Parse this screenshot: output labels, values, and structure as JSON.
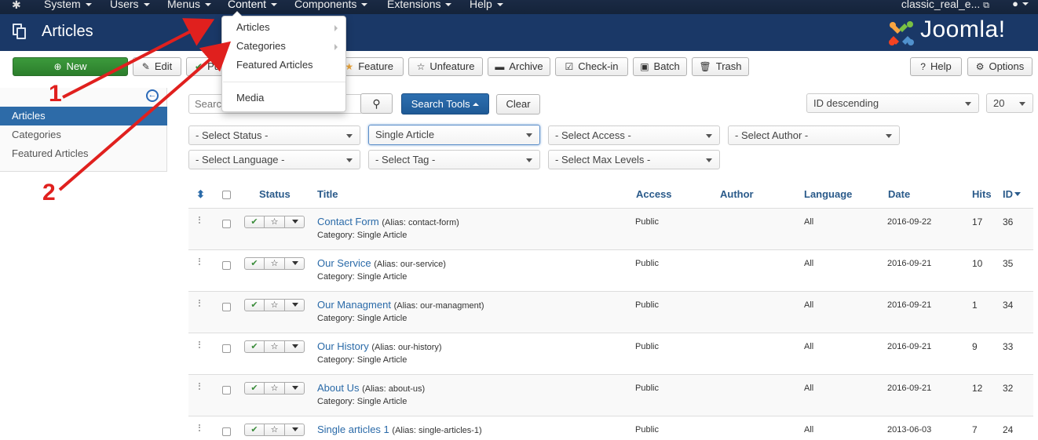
{
  "topnav": {
    "items": [
      {
        "label": "System"
      },
      {
        "label": "Users"
      },
      {
        "label": "Menus"
      },
      {
        "label": "Content"
      },
      {
        "label": "Components"
      },
      {
        "label": "Extensions"
      },
      {
        "label": "Help"
      }
    ],
    "site_name": "classic_real_e...",
    "external_icon": "external-link-icon",
    "user_icon": "user-icon"
  },
  "header": {
    "title": "Articles",
    "brand": "Joomla!"
  },
  "toolbar": {
    "new": "New",
    "edit": "Edit",
    "publish": "Pu",
    "feature": "Feature",
    "unfeature": "Unfeature",
    "archive": "Archive",
    "checkin": "Check-in",
    "batch": "Batch",
    "trash": "Trash",
    "help": "Help",
    "options": "Options"
  },
  "content_menu": {
    "items": [
      {
        "label": "Articles",
        "has_submenu": true
      },
      {
        "label": "Categories",
        "has_submenu": true
      },
      {
        "label": "Featured Articles",
        "has_submenu": false
      },
      {
        "label": "Media",
        "has_submenu": false
      }
    ]
  },
  "sidebar": {
    "items": [
      {
        "label": "Articles",
        "active": true
      },
      {
        "label": "Categories",
        "active": false
      },
      {
        "label": "Featured Articles",
        "active": false
      }
    ]
  },
  "search": {
    "placeholder": "Search",
    "search_tools": "Search Tools",
    "clear": "Clear",
    "ordering": "ID descending",
    "limit": "20"
  },
  "filters": {
    "status": "- Select Status -",
    "category": "Single Article",
    "access": "- Select Access -",
    "author": "- Select Author -",
    "language": "- Select Language -",
    "tag": "- Select Tag -",
    "max_levels": "- Select Max Levels -"
  },
  "table": {
    "headers": {
      "status": "Status",
      "title": "Title",
      "access": "Access",
      "author": "Author",
      "language": "Language",
      "date": "Date",
      "hits": "Hits",
      "id": "ID"
    },
    "rows": [
      {
        "title": "Contact Form",
        "alias": "(Alias: contact-form)",
        "category": "Category: Single Article",
        "access": "Public",
        "language": "All",
        "date": "2016-09-22",
        "hits": "17",
        "id": "36"
      },
      {
        "title": "Our Service",
        "alias": "(Alias: our-service)",
        "category": "Category: Single Article",
        "access": "Public",
        "language": "All",
        "date": "2016-09-21",
        "hits": "10",
        "id": "35"
      },
      {
        "title": "Our Managment",
        "alias": "(Alias: our-managment)",
        "category": "Category: Single Article",
        "access": "Public",
        "language": "All",
        "date": "2016-09-21",
        "hits": "1",
        "id": "34"
      },
      {
        "title": "Our History",
        "alias": "(Alias: our-history)",
        "category": "Category: Single Article",
        "access": "Public",
        "language": "All",
        "date": "2016-09-21",
        "hits": "9",
        "id": "33"
      },
      {
        "title": "About Us",
        "alias": "(Alias: about-us)",
        "category": "Category: Single Article",
        "access": "Public",
        "language": "All",
        "date": "2016-09-21",
        "hits": "12",
        "id": "32"
      },
      {
        "title": "Single articles 1",
        "alias": "(Alias: single-articles-1)",
        "category": "",
        "access": "Public",
        "language": "All",
        "date": "2013-06-03",
        "hits": "7",
        "id": "24"
      }
    ]
  },
  "annotations": {
    "label_1": "1",
    "label_2": "2",
    "color": "#e0201e"
  },
  "colors": {
    "topnav": "#14233a",
    "header": "#1a3867",
    "sidebar_active": "#2d6ba8",
    "new_button": "#2c7e2c",
    "search_tools": "#1f5a96",
    "link": "#2a6aa8"
  }
}
